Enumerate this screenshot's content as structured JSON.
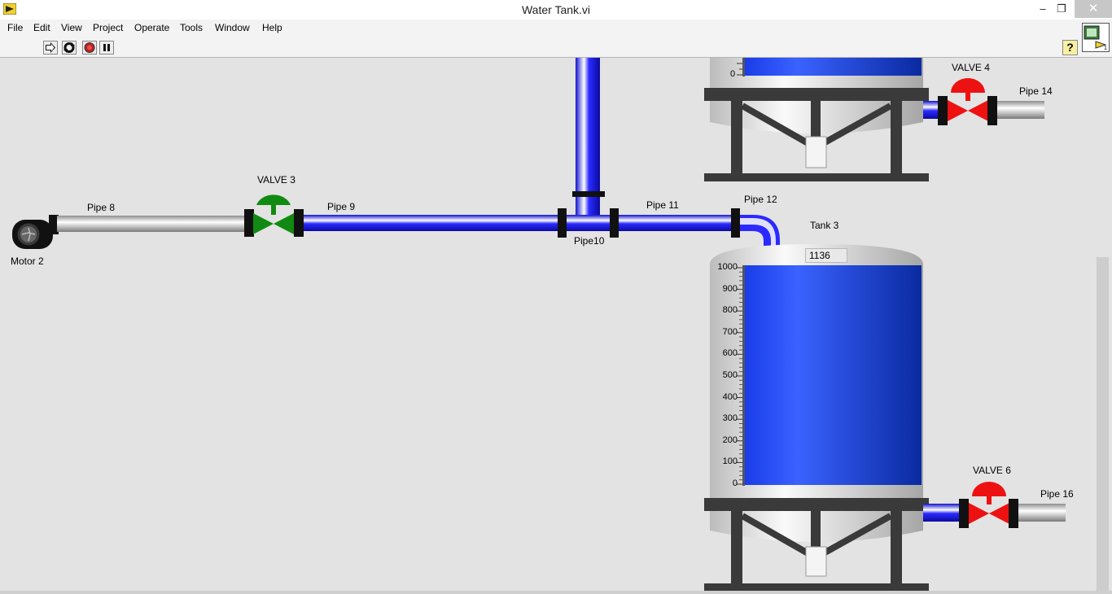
{
  "window": {
    "title": "Water Tank.vi",
    "minimize": "–",
    "restore": "❐",
    "close": "✕"
  },
  "menu": [
    "File",
    "Edit",
    "View",
    "Project",
    "Operate",
    "Tools",
    "Window",
    "Help"
  ],
  "toolbar": {
    "help": "?",
    "icons": [
      "run-arrow-icon",
      "run-continuously-icon",
      "abort-icon",
      "pause-icon"
    ]
  },
  "diagram": {
    "motor": "Motor 2",
    "pipes": {
      "p8": "Pipe 8",
      "p9": "Pipe 9",
      "p10": "Pipe10",
      "p11": "Pipe 11",
      "p12": "Pipe 12",
      "p14": "Pipe 14",
      "p16": "Pipe 16"
    },
    "valves": {
      "v3": {
        "label": "VALVE 3",
        "state": "open",
        "color": "#118a11"
      },
      "v4": {
        "label": "VALVE 4",
        "state": "closed",
        "color": "#ee1111"
      },
      "v6": {
        "label": "VALVE 6",
        "state": "closed",
        "color": "#ee1111"
      }
    },
    "tank_top": {
      "scale_label": "0"
    },
    "tank3": {
      "label": "Tank 3",
      "value": "1136",
      "scale": [
        "1000",
        "900",
        "800",
        "700",
        "600",
        "500",
        "400",
        "300",
        "200",
        "100",
        "0"
      ]
    }
  },
  "colors": {
    "water": "#1f4fe8",
    "pipe_flow": "#2020ff",
    "background": "#e3e3e3"
  }
}
